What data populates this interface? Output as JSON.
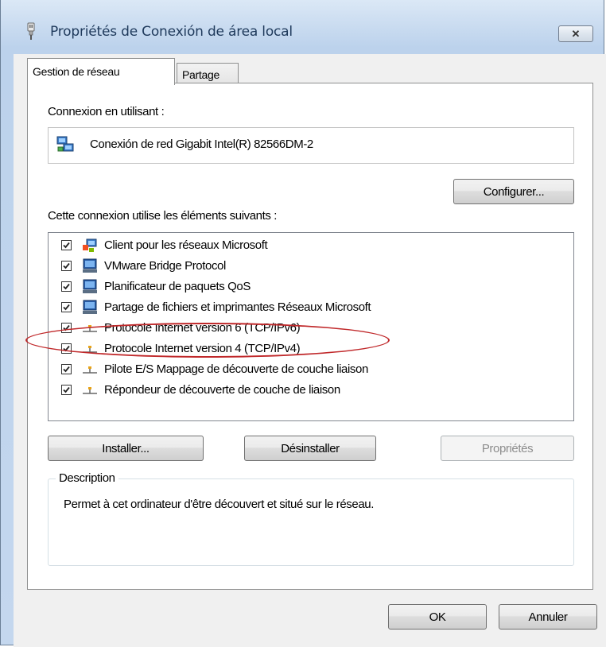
{
  "window": {
    "title": "Propriétés de Conexión de área local",
    "close_symbol": "✕"
  },
  "tabs": [
    {
      "label": "Gestion de réseau",
      "active": true
    },
    {
      "label": "Partage",
      "active": false
    }
  ],
  "connection": {
    "label": "Connexion en utilisant :",
    "adapter_name": "Conexión de red Gigabit Intel(R) 82566DM-2",
    "adapter_icon": "network-adapter-icon",
    "configure_button": "Configurer..."
  },
  "items_section": {
    "label": "Cette connexion utilise les éléments suivants :",
    "items": [
      {
        "label": "Client pour les réseaux Microsoft",
        "checked": true,
        "icon": "network-client-icon"
      },
      {
        "label": "VMware Bridge Protocol",
        "checked": true,
        "icon": "network-service-icon"
      },
      {
        "label": "Planificateur de paquets QoS",
        "checked": true,
        "icon": "network-service-icon"
      },
      {
        "label": "Partage de fichiers et imprimantes Réseaux Microsoft",
        "checked": true,
        "icon": "network-service-icon"
      },
      {
        "label": "Protocole Internet version 6 (TCP/IPv6)",
        "checked": true,
        "icon": "protocol-icon"
      },
      {
        "label": "Protocole Internet version 4 (TCP/IPv4)",
        "checked": true,
        "icon": "protocol-icon"
      },
      {
        "label": "Pilote E/S Mappage de découverte de couche liaison",
        "checked": true,
        "icon": "protocol-icon"
      },
      {
        "label": "Répondeur de découverte de couche de liaison",
        "checked": true,
        "icon": "protocol-icon"
      }
    ]
  },
  "actions": {
    "install": "Installer...",
    "uninstall": "Désinstaller",
    "properties": "Propriétés"
  },
  "description": {
    "legend": "Description",
    "text": "Permet à cet ordinateur d'être découvert et situé sur le réseau."
  },
  "footer": {
    "ok": "OK",
    "cancel": "Annuler"
  },
  "colors": {
    "title_text": "#1e395b",
    "highlight_ellipse": "#c0282a"
  }
}
